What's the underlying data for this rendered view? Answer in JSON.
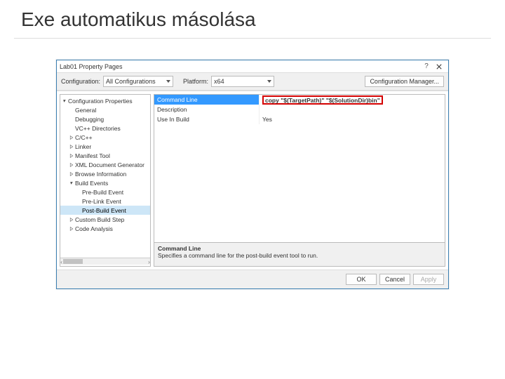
{
  "slide": {
    "title": "Exe automatikus másolása"
  },
  "dialog": {
    "title": "Lab01 Property Pages",
    "help_icon": "?",
    "toolbar": {
      "config_label": "Configuration:",
      "config_value": "All Configurations",
      "platform_label": "Platform:",
      "platform_value": "x64",
      "config_mgr": "Configuration Manager..."
    },
    "tree": [
      {
        "label": "Configuration Properties",
        "depth": 0,
        "exp": "open",
        "bold": false
      },
      {
        "label": "General",
        "depth": 1,
        "exp": "none"
      },
      {
        "label": "Debugging",
        "depth": 1,
        "exp": "none"
      },
      {
        "label": "VC++ Directories",
        "depth": 1,
        "exp": "none"
      },
      {
        "label": "C/C++",
        "depth": 1,
        "exp": "closed"
      },
      {
        "label": "Linker",
        "depth": 1,
        "exp": "closed"
      },
      {
        "label": "Manifest Tool",
        "depth": 1,
        "exp": "closed"
      },
      {
        "label": "XML Document Generator",
        "depth": 1,
        "exp": "closed"
      },
      {
        "label": "Browse Information",
        "depth": 1,
        "exp": "closed"
      },
      {
        "label": "Build Events",
        "depth": 1,
        "exp": "open"
      },
      {
        "label": "Pre-Build Event",
        "depth": 2,
        "exp": "none"
      },
      {
        "label": "Pre-Link Event",
        "depth": 2,
        "exp": "none"
      },
      {
        "label": "Post-Build Event",
        "depth": 2,
        "exp": "none",
        "sel": true
      },
      {
        "label": "Custom Build Step",
        "depth": 1,
        "exp": "closed"
      },
      {
        "label": "Code Analysis",
        "depth": 1,
        "exp": "closed"
      }
    ],
    "grid": [
      {
        "name": "Command Line",
        "value": "copy \"$(TargetPath)\" \"$(SolutionDir)bin\"",
        "selected": true,
        "highlight": true
      },
      {
        "name": "Description",
        "value": ""
      },
      {
        "name": "Use In Build",
        "value": "Yes"
      }
    ],
    "desc": {
      "name": "Command Line",
      "text": "Specifies a command line for the post-build event tool to run."
    },
    "footer": {
      "ok": "OK",
      "cancel": "Cancel",
      "apply": "Apply"
    }
  }
}
